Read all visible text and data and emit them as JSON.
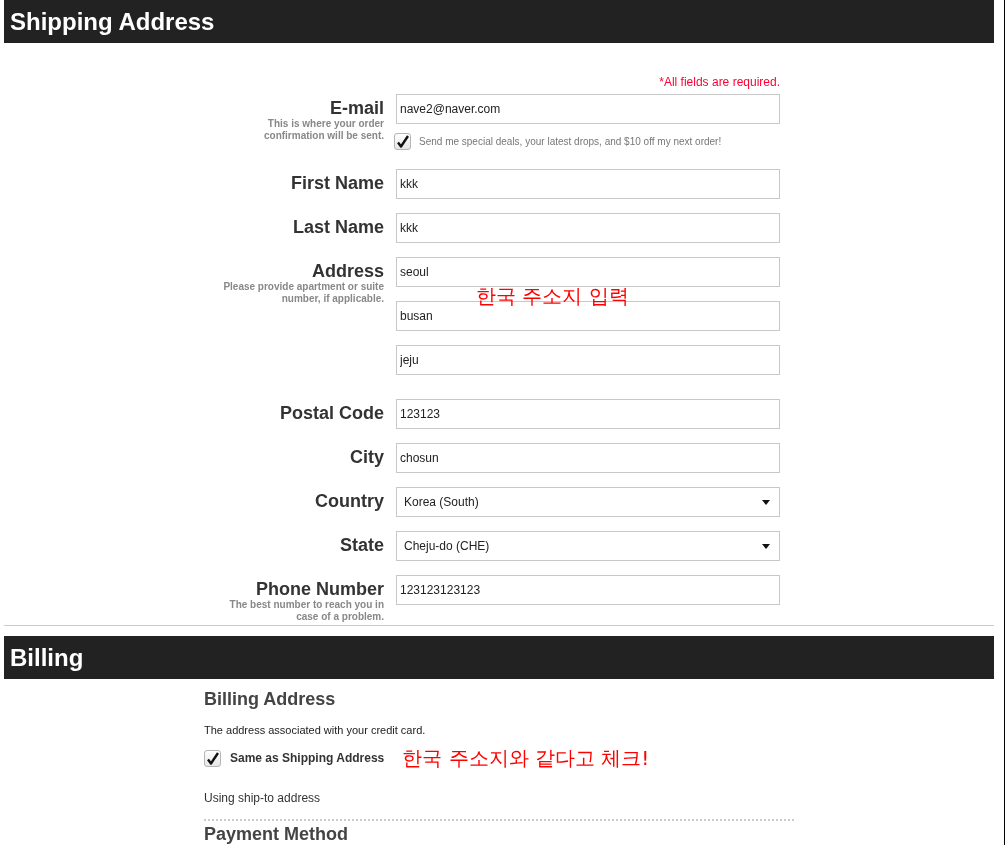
{
  "shipping": {
    "header": "Shipping Address",
    "required_note": "*All fields are required.",
    "fields": [
      {
        "kind": "text",
        "label": "E-mail",
        "hint": "This is where your order confirmation will be sent.",
        "values": [
          "nave2@naver.com"
        ],
        "option": {
          "label": "Send me special deals, your latest drops, and $10 off my next order!",
          "checked": true
        }
      },
      {
        "kind": "text",
        "label": "First Name",
        "values": [
          "kkk"
        ]
      },
      {
        "kind": "text",
        "label": "Last Name",
        "values": [
          "kkk"
        ]
      },
      {
        "kind": "text",
        "label": "Address",
        "hint": "Please provide apartment or suite number, if applicable.",
        "values": [
          "seoul",
          "busan",
          "jeju"
        ],
        "annotation": "한국 주소지 입력"
      },
      {
        "kind": "text",
        "label": "Postal Code",
        "values": [
          "123123"
        ]
      },
      {
        "kind": "text",
        "label": "City",
        "values": [
          "chosun"
        ]
      },
      {
        "kind": "select",
        "label": "Country",
        "values": [
          "Korea (South)"
        ]
      },
      {
        "kind": "select",
        "label": "State",
        "values": [
          "Cheju-do (CHE)"
        ]
      },
      {
        "kind": "text",
        "label": "Phone Number",
        "hint": "The best number to reach you in case of a problem.",
        "values": [
          "123123123123"
        ]
      }
    ]
  },
  "billing": {
    "header": "Billing",
    "address_heading": "Billing Address",
    "address_note": "The address associated with your credit card.",
    "same_as_shipping": {
      "label": "Same as Shipping Address",
      "checked": true,
      "annotation": "한국 주소지와 같다고 체크!"
    },
    "status": "Using ship-to address",
    "next_heading": "Payment Method"
  }
}
